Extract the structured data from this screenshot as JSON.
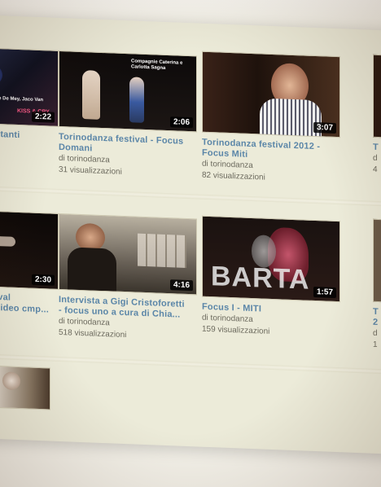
{
  "videos": [
    {
      "title_lines": [
        "stanti"
      ],
      "duration": "2:22",
      "channel": "",
      "views": "",
      "caption": "Michele Anne De Mey, Jaco Van Dormael",
      "caption2": "KISS & CRY"
    },
    {
      "title_lines": [
        "Torinodanza festival - Focus",
        "Domani"
      ],
      "duration": "2:06",
      "channel": "di torinodanza",
      "views": "31 visualizzazioni",
      "caption": "Compagnie Caterina e Carlotta Sagna"
    },
    {
      "title_lines": [
        "Torinodanza festival 2012 -",
        "Focus Miti"
      ],
      "duration": "3:07",
      "channel": "di torinodanza",
      "views": "82 visualizzazioni"
    },
    {
      "title_lines": [
        "T"
      ],
      "duration": "",
      "channel": "d",
      "views": "4"
    },
    {
      "title_lines": [
        "ival",
        "video cmp..."
      ],
      "duration": "2:30",
      "channel": "",
      "views": ""
    },
    {
      "title_lines": [
        "Intervista a Gigi Cristoforetti",
        "- focus uno a cura di Chia..."
      ],
      "duration": "4:16",
      "channel": "di torinodanza",
      "views": "518 visualizzazioni"
    },
    {
      "title_lines": [
        "Focus I - MITI"
      ],
      "duration": "1:57",
      "channel": "di torinodanza",
      "views": "159 visualizzazioni",
      "overlay": "BARTA"
    },
    {
      "title_lines": [
        "T",
        "2"
      ],
      "duration": "",
      "channel": "d",
      "views": "1"
    }
  ],
  "colors": {
    "title": "#5b86a8",
    "meta": "#6c6a5e",
    "panel": "#ecebd9"
  }
}
